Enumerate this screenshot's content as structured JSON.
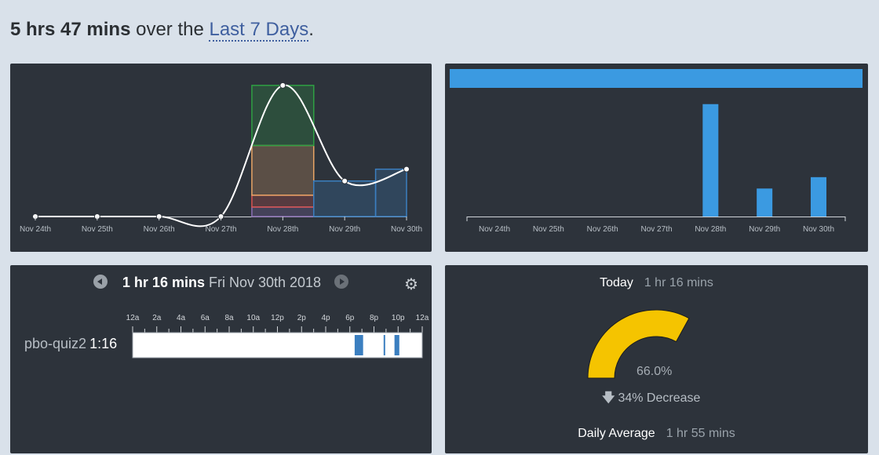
{
  "header": {
    "total": "5 hrs 47 mins",
    "middle": "over the",
    "range": "Last 7 Days",
    "end": "."
  },
  "chart_data": [
    {
      "type": "bar",
      "subtype": "stacked-area-smoothed",
      "categories": [
        "Nov 24th",
        "Nov 25th",
        "Nov 26th",
        "Nov 27th",
        "Nov 28th",
        "Nov 29th",
        "Nov 30th"
      ],
      "series": [
        {
          "color": "#8a6fb3",
          "values": [
            0,
            0,
            0,
            0,
            0.2,
            0,
            0
          ]
        },
        {
          "color": "#d9534f",
          "values": [
            0,
            0,
            0,
            0,
            0.25,
            0,
            0
          ]
        },
        {
          "color": "#e8a466",
          "values": [
            0,
            0,
            0,
            0,
            1.05,
            0,
            0
          ]
        },
        {
          "color": "#2ea043",
          "values": [
            0,
            0,
            0,
            0,
            1.27,
            0,
            0
          ]
        },
        {
          "color": "#3b7fc0",
          "values": [
            0,
            0,
            0,
            0,
            0,
            0.75,
            1.0
          ]
        }
      ],
      "totals": [
        0,
        0,
        0,
        0,
        2.77,
        0.75,
        1.0
      ],
      "ylim": [
        0,
        2.9
      ]
    },
    {
      "type": "bar",
      "categories": [
        "Nov 24th",
        "Nov 25th",
        "Nov 26th",
        "Nov 27th",
        "Nov 28th",
        "Nov 29th",
        "Nov 30th"
      ],
      "values": [
        0,
        0,
        0,
        0,
        2.77,
        0.69,
        0.97
      ],
      "ylim": [
        0,
        2.9
      ],
      "color": "#3b9ae1",
      "top_bar_color": "#3b9ae1"
    }
  ],
  "day": {
    "duration": "1 hr 16 mins",
    "date": "Fri Nov 30th 2018",
    "hour_labels": [
      "12a",
      "2a",
      "4a",
      "6a",
      "8a",
      "10a",
      "12p",
      "2p",
      "4p",
      "6p",
      "8p",
      "10p",
      "12a"
    ],
    "project": "pbo-quiz2",
    "project_time": "1:16",
    "bar_color": "#3b7fc0",
    "segments": [
      [
        18.4,
        19.1
      ],
      [
        20.8,
        20.9
      ],
      [
        21.7,
        22.1
      ]
    ]
  },
  "stats": {
    "today_label": "Today",
    "today_value": "1 hr 16 mins",
    "gauge_percent": 66.0,
    "gauge_label": "66.0%",
    "gauge_color": "#f5c400",
    "change_text": "34% Decrease",
    "avg_label": "Daily Average",
    "avg_value": "1 hr 55 mins"
  }
}
